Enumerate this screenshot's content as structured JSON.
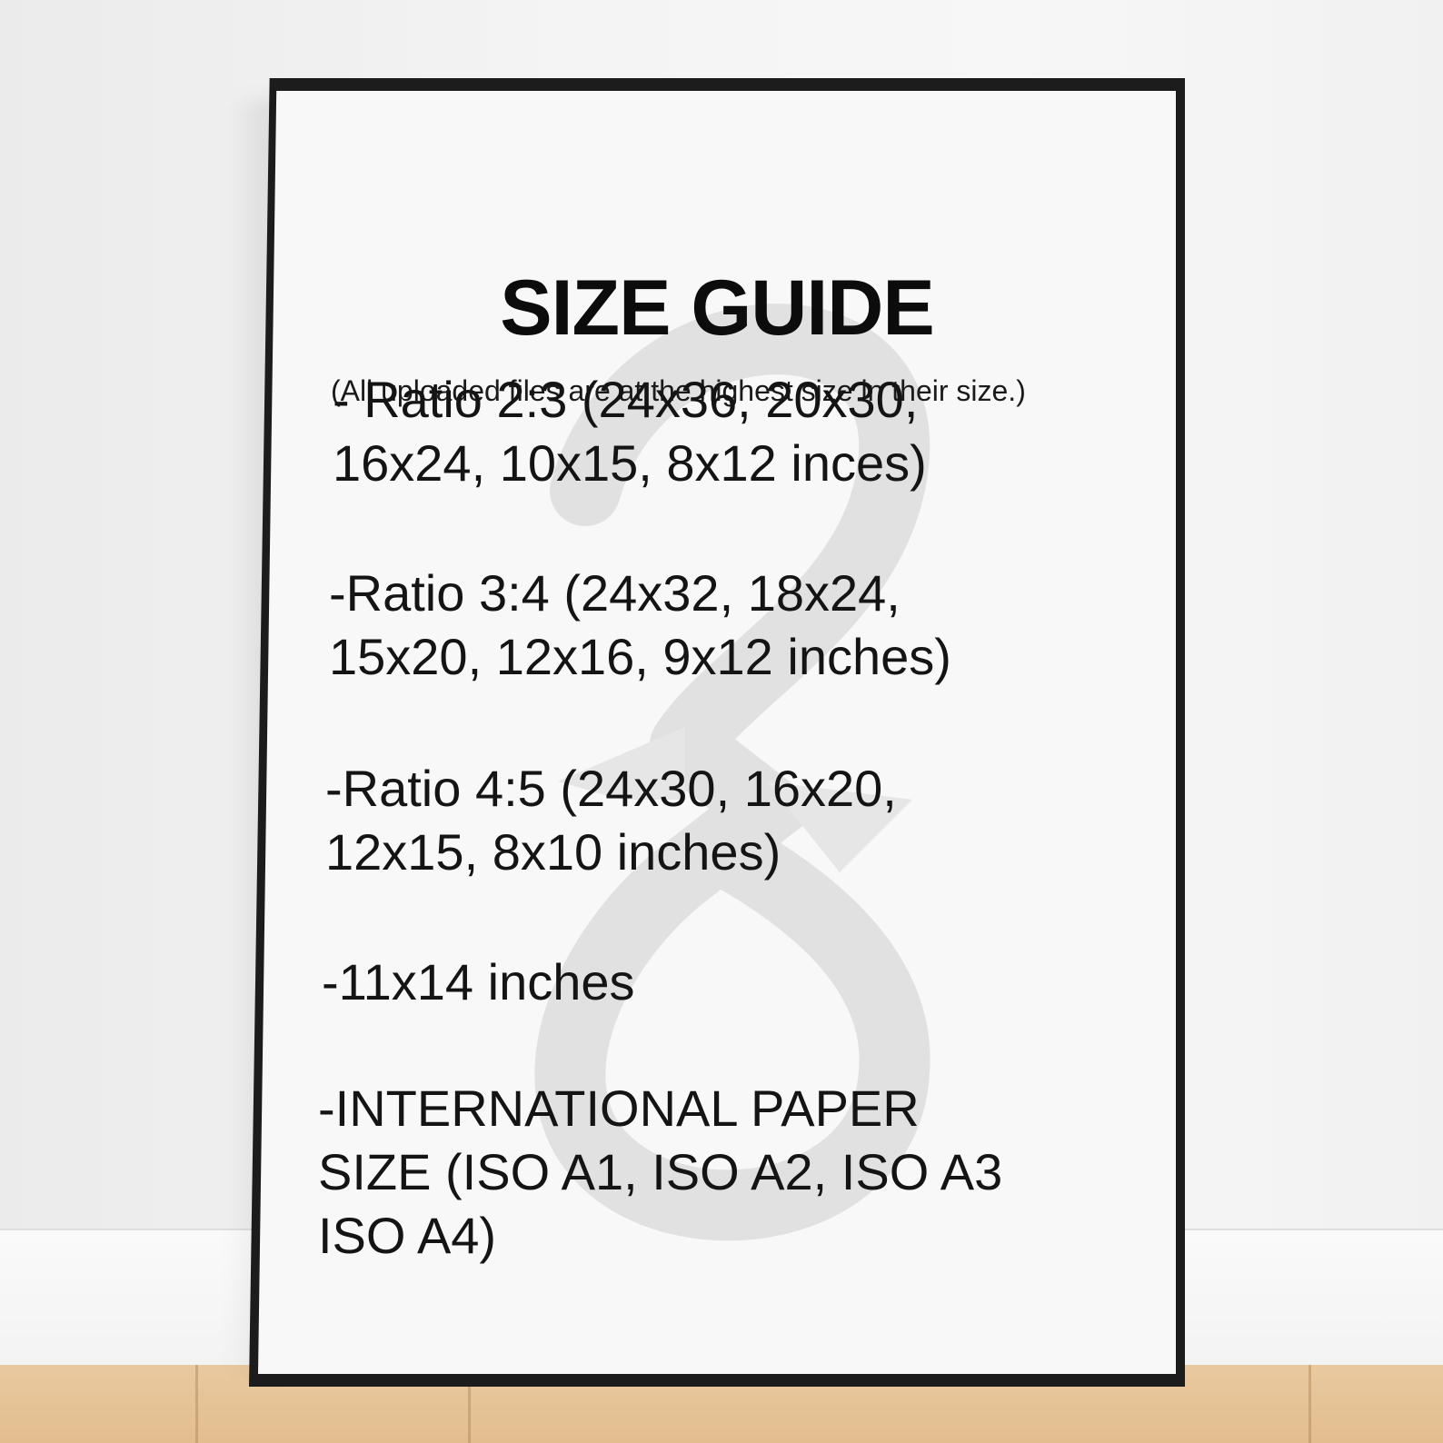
{
  "poster": {
    "title": "SIZE GUIDE",
    "subtitle": "(All uploaded files are at the highest size in their size.)",
    "entries": [
      {
        "lines": [
          "- Ratio 2:3 (24x36, 20x30,",
          "16x24, 10x15, 8x12 inces)"
        ]
      },
      {
        "lines": [
          "-Ratio 3:4 (24x32, 18x24,",
          "15x20, 12x16, 9x12 inches)"
        ]
      },
      {
        "lines": [
          "-Ratio 4:5 (24x30,  16x20,",
          "12x15, 8x10 inches)"
        ]
      },
      {
        "lines": [
          "-11x14 inches"
        ]
      },
      {
        "lines": [
          "-INTERNATIONAL PAPER",
          "SIZE (ISO A1, ISO A2, ISO A3",
          "ISO A4)"
        ]
      }
    ],
    "watermark_icon": "infinity-figure-eight-icon"
  },
  "colors": {
    "frame": "#1c1c1c",
    "paper": "#f8f8f8",
    "text": "#141414",
    "watermark": "#e1e1e1",
    "floor": "#e5c497"
  }
}
